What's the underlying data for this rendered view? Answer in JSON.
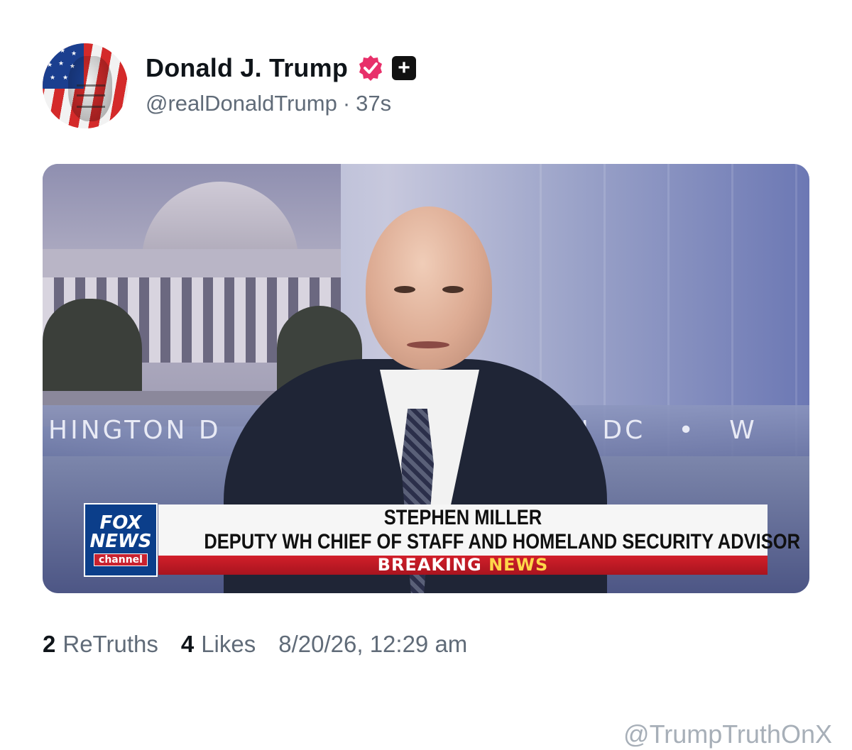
{
  "post": {
    "author": {
      "name": "Donald J. Trump",
      "handle": "@realDonaldTrump",
      "separator": "·",
      "time": "37s",
      "plus_glyph": "+",
      "verified_icon": "verified-badge-icon",
      "verified_color": "#e8306a"
    },
    "media": {
      "background_text_left": "HINGTON D",
      "background_text_right": "N DC   •   W",
      "logo": {
        "line1": "FOX",
        "line2": "NEWS",
        "line3": "channel"
      },
      "chyron": {
        "name": "STEPHEN MILLER",
        "title": "DEPUTY WH CHIEF OF STAFF AND HOMELAND SECURITY ADVISOR",
        "banner_part1": "BREAKING",
        "banner_part2": "NEWS"
      }
    },
    "stats": {
      "retruths_count": "2",
      "retruths_label": "ReTruths",
      "likes_count": "4",
      "likes_label": "Likes",
      "timestamp": "8/20/26, 12:29 am"
    }
  },
  "watermark": "@TrumpTruthOnX",
  "colors": {
    "text_primary": "#0f1419",
    "text_secondary": "#606b78",
    "verified_badge": "#e8306a",
    "watermark": "#a7afb8"
  }
}
